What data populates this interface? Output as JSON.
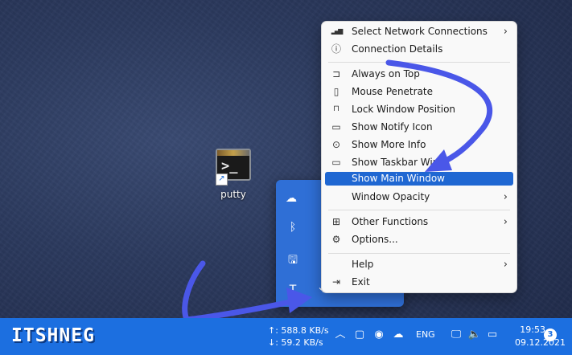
{
  "desktop": {
    "icon_label": "putty",
    "icon_prompt": ">_"
  },
  "menu": {
    "items": [
      {
        "label": "Select Network Connections",
        "icon": "signal-bars-icon",
        "glyph": "▂▄▆",
        "submenu": true
      },
      {
        "label": "Connection Details",
        "icon": "info-icon",
        "glyph": "ⓘ",
        "submenu": false
      },
      {
        "label": "Always on Top",
        "icon": "pin-icon",
        "glyph": "⊐",
        "submenu": false
      },
      {
        "label": "Mouse Penetrate",
        "icon": "mouse-icon",
        "glyph": "▯",
        "submenu": false
      },
      {
        "label": "Lock Window Position",
        "icon": "lock-icon",
        "glyph": "🔒",
        "submenu": false
      },
      {
        "label": "Show Notify Icon",
        "icon": "monitor-icon",
        "glyph": "🖵",
        "submenu": false
      },
      {
        "label": "Show More Info",
        "icon": "more-icon",
        "glyph": "⋯",
        "submenu": false
      },
      {
        "label": "Show Taskbar Wind",
        "icon": "laptop-icon",
        "glyph": "▭",
        "submenu": false
      },
      {
        "label": "Show Main Window",
        "icon": "",
        "glyph": "",
        "submenu": false,
        "highlighted": true
      },
      {
        "label": "Window Opacity",
        "icon": "",
        "glyph": "",
        "submenu": true
      },
      {
        "label": "Other Functions",
        "icon": "grid-icon",
        "glyph": "⊞",
        "submenu": true
      },
      {
        "label": "Options...",
        "icon": "gear-icon",
        "glyph": "⚙",
        "submenu": false
      },
      {
        "label": "Help",
        "icon": "",
        "glyph": "",
        "submenu": true
      },
      {
        "label": "Exit",
        "icon": "exit-icon",
        "glyph": "⇥",
        "submenu": false
      }
    ]
  },
  "taskbar": {
    "brand": "ITSHNEG",
    "upload": "↑: 588.8 KB/s",
    "download": "↓: 59.2 KB/s",
    "language": "ENG",
    "time": "19:53",
    "date": "09.12.2021",
    "notification_count": "3"
  },
  "colors": {
    "taskbar": "#1c6fe0",
    "highlight": "#1f67d2",
    "annotation_arrow": "#4a57e8"
  }
}
